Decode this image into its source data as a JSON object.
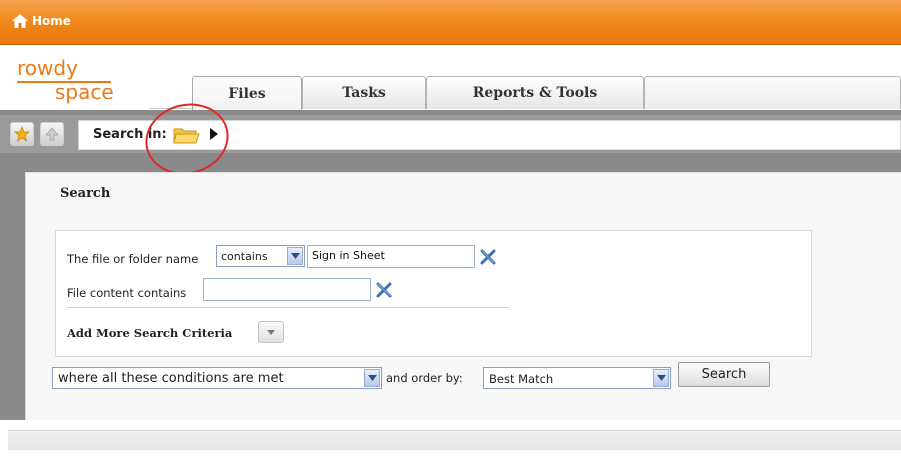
{
  "topbar": {
    "home_label": "Home"
  },
  "logo": {
    "line1": "rowdy",
    "line2": "space"
  },
  "tabs": [
    {
      "label": "Files",
      "active": true
    },
    {
      "label": "Tasks",
      "active": false
    },
    {
      "label": "Reports & Tools",
      "active": false
    }
  ],
  "toolbar": {
    "search_in_label": "Search in:"
  },
  "search": {
    "title": "Search",
    "name_label": "The file or folder name",
    "name_operator": "contains",
    "name_value": "Sign in Sheet",
    "content_label": "File content contains",
    "content_value": "",
    "add_more_label": "Add More Search Criteria",
    "condition_value": "where all these conditions are met",
    "order_label": "and order by:",
    "order_value": "Best Match",
    "search_button": "Search"
  },
  "colors": {
    "brand_orange": "#f08a1c",
    "highlight_circle": "#dd2b2b"
  }
}
